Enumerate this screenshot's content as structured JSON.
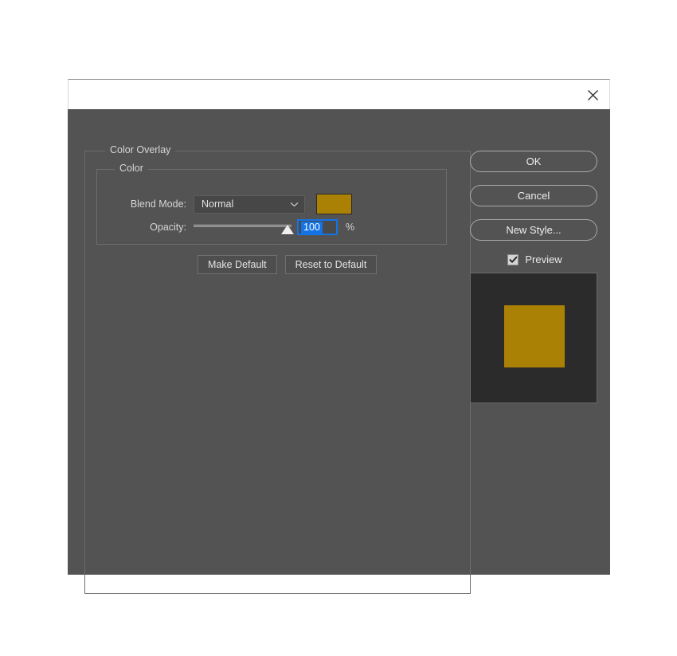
{
  "window": {
    "title": "",
    "close_icon": "close-x-icon"
  },
  "panel": {
    "outer_group_label": "Color Overlay",
    "inner_group_label": "Color"
  },
  "blend_mode": {
    "label": "Blend Mode:",
    "value": "Normal",
    "chevron_icon": "chevron-down-icon",
    "options": [
      "Normal"
    ]
  },
  "color": {
    "swatch_hex": "#ab8105",
    "swatch_border_hex": "#2a2a2a"
  },
  "opacity": {
    "label": "Opacity:",
    "value": "100",
    "unit": "%",
    "slider_percent": 100,
    "min": 0,
    "max": 100,
    "focus_hex": "#1473e6"
  },
  "default_buttons": {
    "make_default": "Make Default",
    "reset_to_default": "Reset to Default"
  },
  "actions": {
    "ok": "OK",
    "cancel": "Cancel",
    "new_style": "New Style..."
  },
  "preview": {
    "label": "Preview",
    "checked": true,
    "check_icon": "checkmark-icon",
    "thumb_background_hex": "#2b2b2b",
    "thumb_shape_hex": "#ab8105"
  },
  "theme": {
    "dialog_background_hex": "#535353",
    "titlebar_background_hex": "#ffffff",
    "text_hex": "#d6d6d6",
    "border_hex": "#6d6d6d"
  }
}
